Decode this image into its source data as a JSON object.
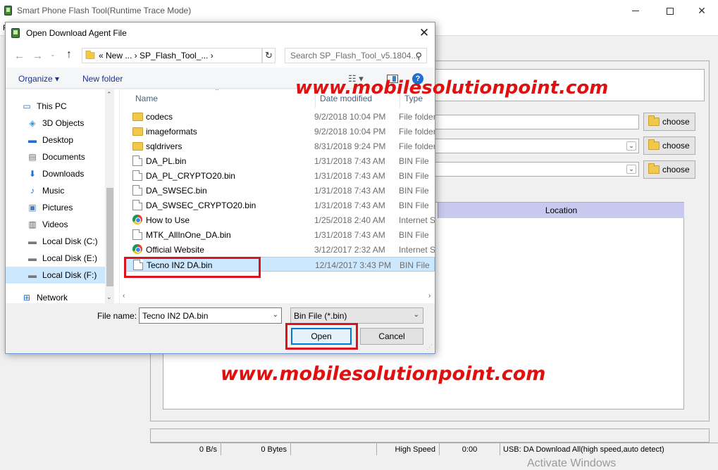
{
  "main_window": {
    "title": "Smart Phone Flash Tool(Runtime Trace Mode)",
    "menu_letter": "F",
    "choose_label": "choose",
    "location_header": "Location",
    "status": {
      "speed": "0 B/s",
      "bytes": "0 Bytes",
      "mode": "High Speed",
      "time": "0:00",
      "usb": "USB: DA Download All(high speed,auto detect)"
    },
    "activate_text": "Activate Windows"
  },
  "watermark": "www.mobilesolutionpoint.com",
  "dialog": {
    "title": "Open Download Agent File",
    "address": {
      "crumbs": "«  New ...  ›  SP_Flash_Tool_...  ›",
      "search_placeholder": "Search SP_Flash_Tool_v5.1804..."
    },
    "toolbar": {
      "organize": "Organize ▾",
      "new_folder": "New folder"
    },
    "nav": [
      {
        "label": "This PC",
        "icon": "monitor-icon"
      },
      {
        "label": "3D Objects",
        "icon": "cube-icon"
      },
      {
        "label": "Desktop",
        "icon": "desktop-icon"
      },
      {
        "label": "Documents",
        "icon": "document-icon"
      },
      {
        "label": "Downloads",
        "icon": "download-arrow-icon"
      },
      {
        "label": "Music",
        "icon": "music-note-icon"
      },
      {
        "label": "Pictures",
        "icon": "picture-icon"
      },
      {
        "label": "Videos",
        "icon": "film-icon"
      },
      {
        "label": "Local Disk (C:)",
        "icon": "drive-icon"
      },
      {
        "label": "Local Disk (E:)",
        "icon": "drive-icon"
      },
      {
        "label": "Local Disk (F:)",
        "icon": "drive-icon",
        "selected": true
      },
      {
        "label": "Network",
        "icon": "network-icon"
      }
    ],
    "columns": {
      "name": "Name",
      "date": "Date modified",
      "type": "Type"
    },
    "files": [
      {
        "name": "codecs",
        "date": "9/2/2018 10:04 PM",
        "type": "File folder",
        "icon": "folder"
      },
      {
        "name": "imageformats",
        "date": "9/2/2018 10:04 PM",
        "type": "File folder",
        "icon": "folder"
      },
      {
        "name": "sqldrivers",
        "date": "8/31/2018 9:24 PM",
        "type": "File folder",
        "icon": "folder"
      },
      {
        "name": "DA_PL.bin",
        "date": "1/31/2018 7:43 AM",
        "type": "BIN File",
        "icon": "file"
      },
      {
        "name": "DA_PL_CRYPTO20.bin",
        "date": "1/31/2018 7:43 AM",
        "type": "BIN File",
        "icon": "file"
      },
      {
        "name": "DA_SWSEC.bin",
        "date": "1/31/2018 7:43 AM",
        "type": "BIN File",
        "icon": "file"
      },
      {
        "name": "DA_SWSEC_CRYPTO20.bin",
        "date": "1/31/2018 7:43 AM",
        "type": "BIN File",
        "icon": "file"
      },
      {
        "name": "How to Use",
        "date": "1/25/2018 2:40 AM",
        "type": "Internet S",
        "icon": "chrome"
      },
      {
        "name": "MTK_AllInOne_DA.bin",
        "date": "1/31/2018 7:43 AM",
        "type": "BIN File",
        "icon": "file"
      },
      {
        "name": "Official Website",
        "date": "3/12/2017 2:32 AM",
        "type": "Internet S",
        "icon": "chrome"
      },
      {
        "name": "Tecno IN2 DA.bin",
        "date": "12/14/2017 3:43 PM",
        "type": "BIN File",
        "icon": "file",
        "selected": true
      }
    ],
    "file_name_label": "File name:",
    "file_name_value": "Tecno IN2 DA.bin",
    "file_type_value": "Bin File (*.bin)",
    "open_label": "Open",
    "cancel_label": "Cancel"
  }
}
